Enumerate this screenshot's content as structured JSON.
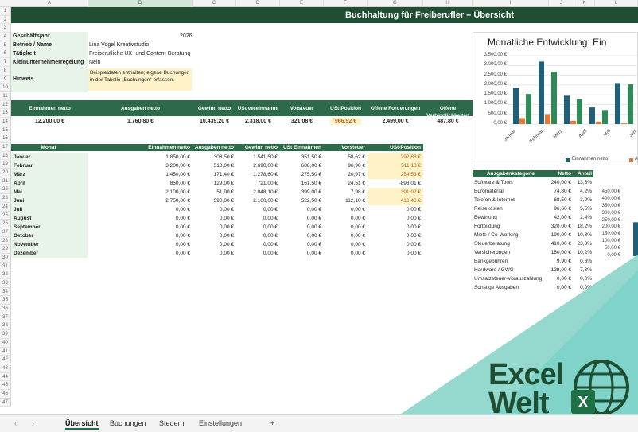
{
  "columns": [
    "A",
    "B",
    "C",
    "D",
    "E",
    "F",
    "G",
    "H",
    "I",
    "J",
    "K",
    "L"
  ],
  "rows": [
    "1",
    "2",
    "3",
    "4",
    "5",
    "6",
    "7",
    "8",
    "9",
    "10",
    "11",
    "12",
    "13",
    "14",
    "15",
    "16",
    "17",
    "18",
    "19",
    "20",
    "21",
    "22",
    "23",
    "24",
    "25",
    "26",
    "27",
    "28",
    "29",
    "30",
    "31",
    "32",
    "33",
    "34",
    "35",
    "36",
    "37",
    "38",
    "39",
    "40",
    "41",
    "42",
    "43",
    "44",
    "45",
    "46",
    "47"
  ],
  "title": "Buchhaltung für Freiberufler – Übersicht",
  "info": {
    "fiscal_year_label": "Geschäftsjahr",
    "fiscal_year": "2026",
    "business_label": "Betrieb / Name",
    "business": "Lina Vogel Kreativstudio",
    "activity_label": "Tätigkeit",
    "activity": "Freiberufliche UX- und Content-Beratung",
    "small_business_label": "Kleinunternehmerregelung",
    "small_business": "Nein",
    "note_label": "Hinweis",
    "note": "Beispieldaten enthalten; eigene Buchungen in der Tabelle „Buchungen“ erfassen."
  },
  "kpis": [
    {
      "label": "Einnahmen netto",
      "value": "12.200,00 €"
    },
    {
      "label": "Ausgaben netto",
      "value": "1.760,80 €"
    },
    {
      "label": "Gewinn netto",
      "value": "10.439,20 €"
    },
    {
      "label": "USt vereinnahmt",
      "value": "2.318,00 €"
    },
    {
      "label": "Vorsteuer",
      "value": "321,08 €"
    },
    {
      "label": "USt-Position",
      "value": "966,92 €"
    },
    {
      "label": "Offene Forderungen",
      "value": "2.499,00 €"
    },
    {
      "label": "Offene Verbindlichkeiten",
      "value": "487,80 €"
    }
  ],
  "monthly": {
    "headers": [
      "Monat",
      "Einnahmen netto",
      "Ausgaben netto",
      "Gewinn netto",
      "USt Einnahmen",
      "Vorsteuer",
      "USt-Position"
    ],
    "rows": [
      [
        "Januar",
        "1.850,00 €",
        "308,50 €",
        "1.541,50 €",
        "351,50 €",
        "58,62 €",
        "292,88 €"
      ],
      [
        "Februar",
        "3.200,00 €",
        "510,00 €",
        "2.690,00 €",
        "608,00 €",
        "96,90 €",
        "511,10 €"
      ],
      [
        "März",
        "1.450,00 €",
        "171,40 €",
        "1.278,60 €",
        "275,50 €",
        "20,97 €",
        "254,53 €"
      ],
      [
        "April",
        "850,00 €",
        "129,00 €",
        "721,00 €",
        "161,50 €",
        "24,51 €",
        "-893,01 €"
      ],
      [
        "Mai",
        "2.100,00 €",
        "51,90 €",
        "2.048,10 €",
        "399,00 €",
        "7,98 €",
        "391,02 €"
      ],
      [
        "Juni",
        "2.750,00 €",
        "590,00 €",
        "2.160,00 €",
        "522,50 €",
        "112,10 €",
        "410,40 €"
      ],
      [
        "Juli",
        "0,00 €",
        "0,00 €",
        "0,00 €",
        "0,00 €",
        "0,00 €",
        "0,00 €"
      ],
      [
        "August",
        "0,00 €",
        "0,00 €",
        "0,00 €",
        "0,00 €",
        "0,00 €",
        "0,00 €"
      ],
      [
        "September",
        "0,00 €",
        "0,00 €",
        "0,00 €",
        "0,00 €",
        "0,00 €",
        "0,00 €"
      ],
      [
        "Oktober",
        "0,00 €",
        "0,00 €",
        "0,00 €",
        "0,00 €",
        "0,00 €",
        "0,00 €"
      ],
      [
        "November",
        "0,00 €",
        "0,00 €",
        "0,00 €",
        "0,00 €",
        "0,00 €",
        "0,00 €"
      ],
      [
        "Dezember",
        "0,00 €",
        "0,00 €",
        "0,00 €",
        "0,00 €",
        "0,00 €",
        "0,00 €"
      ]
    ],
    "highlight_rows": [
      0,
      1,
      2,
      4,
      5
    ]
  },
  "categories": {
    "headers": [
      "Ausgabenkategorie",
      "Netto",
      "Anteil"
    ],
    "rows": [
      [
        "Software & Tools",
        "240,00 €",
        "13,6%"
      ],
      [
        "Büromaterial",
        "74,80 €",
        "4,2%"
      ],
      [
        "Telefon & Internet",
        "68,50 €",
        "3,9%"
      ],
      [
        "Reisekosten",
        "96,60 €",
        "5,5%"
      ],
      [
        "Bewirtung",
        "42,00 €",
        "2,4%"
      ],
      [
        "Fortbildung",
        "320,00 €",
        "18,2%"
      ],
      [
        "Miete / Co-Working",
        "190,00 €",
        "10,8%"
      ],
      [
        "Steuerberatung",
        "410,00 €",
        "23,3%"
      ],
      [
        "Versicherungen",
        "180,00 €",
        "10,2%"
      ],
      [
        "Bankgebühren",
        "9,90 €",
        "0,6%"
      ],
      [
        "Hardware / GWG",
        "129,00 €",
        "7,3%"
      ],
      [
        "Umsatzsteuer-Vorauszahlung",
        "0,00 €",
        "0,0%"
      ],
      [
        "Sonstige Ausgaben",
        "0,00 €",
        "0,0%"
      ]
    ]
  },
  "chart_data": [
    {
      "type": "bar",
      "title": "Monatliche Entwicklung: Ein",
      "categories": [
        "Januar",
        "Februar",
        "März",
        "April",
        "Mai",
        "Juni"
      ],
      "series": [
        {
          "name": "Einnahmen netto",
          "values": [
            1850,
            3200,
            1450,
            850,
            2100,
            2750
          ]
        },
        {
          "name": "Au",
          "values": [
            308.5,
            510,
            171.4,
            129,
            51.9,
            590
          ]
        },
        {
          "values": [
            1541.5,
            2690,
            1278.6,
            721,
            2048.1,
            2160
          ]
        }
      ],
      "y_tick_labels": [
        "3.500,00 €",
        "3.000,00 €",
        "2.500,00 €",
        "2.000,00 €",
        "1.500,00 €",
        "1.000,00 €",
        "500,00 €",
        "0,00 €"
      ],
      "ylim": [
        0,
        3500
      ],
      "legend": "bottom",
      "colors": [
        "#1f5f7a",
        "#e07b39",
        "#2e8b57"
      ]
    },
    {
      "type": "bar",
      "y_tick_labels": [
        "450,00 €",
        "400,00 €",
        "350,00 €",
        "300,00 €",
        "250,00 €",
        "200,00 €",
        "150,00 €",
        "100,00 €",
        "50,00 €",
        "0,00 €"
      ],
      "ylim": [
        0,
        450
      ],
      "values": [
        240
      ]
    }
  ],
  "tabs": [
    "Übersicht",
    "Buchungen",
    "Steuern",
    "Einstellungen"
  ],
  "add_tab": "+",
  "logo": {
    "line1": "Excel",
    "line2": "Welt",
    "colors": {
      "dark": "#1f4e33",
      "teal": "#7fd3c8"
    }
  }
}
